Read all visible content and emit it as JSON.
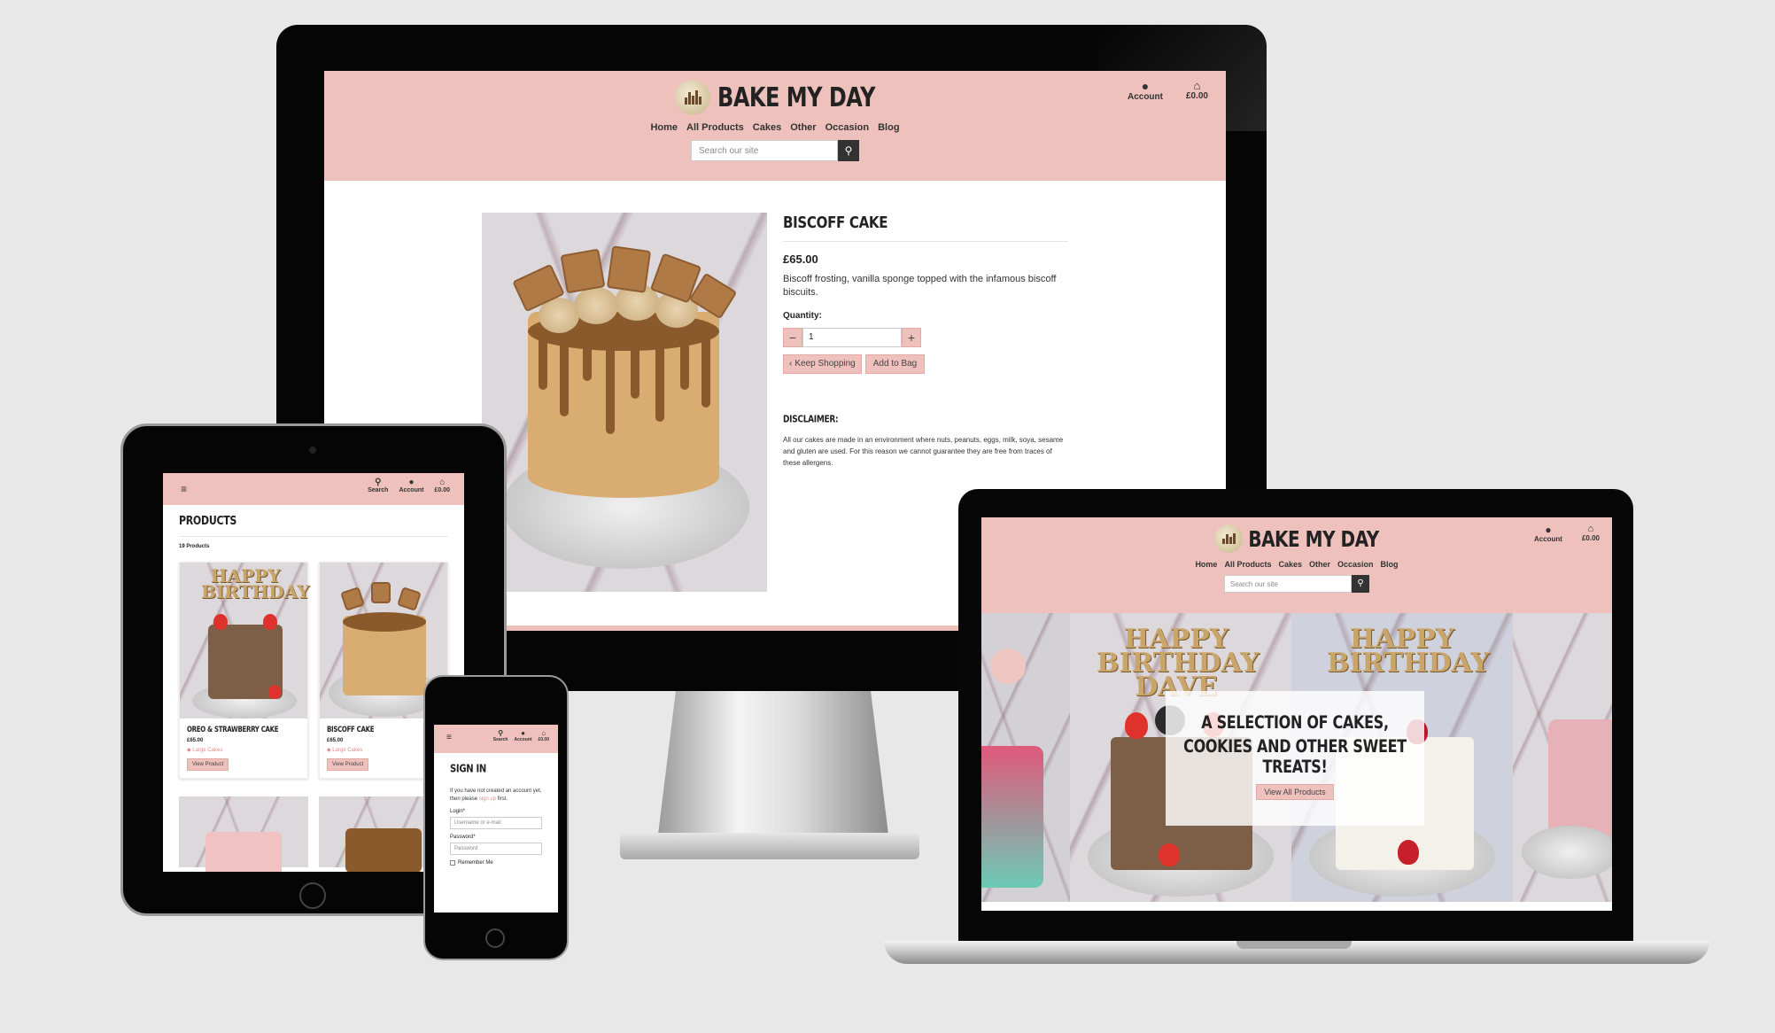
{
  "site": {
    "brand": "BAKE MY DAY",
    "nav": [
      "Home",
      "All Products",
      "Cakes",
      "Other",
      "Occasion",
      "Blog"
    ],
    "search_placeholder": "Search our site",
    "account_label": "Account",
    "search_label": "Search",
    "bag_total": "£0.00"
  },
  "product_page": {
    "title": "BISCOFF CAKE",
    "price": "£65.00",
    "description": "Biscoff frosting, vanilla sponge topped with the infamous biscoff biscuits.",
    "quantity_label": "Quantity:",
    "quantity_value": "1",
    "minus": "−",
    "plus": "+",
    "keep_shopping": "Keep Shopping",
    "add_to_bag": "Add to Bag",
    "disclaimer_title": "DISCLAIMER:",
    "disclaimer_text": "All our cakes are made in an environment where nuts, peanuts, eggs, milk, soya, sesame and gluten are used. For this reason we cannot guarantee they are free from traces of these allergens."
  },
  "products_page": {
    "title": "PRODUCTS",
    "count": "19 Products",
    "cards": [
      {
        "name": "OREO & STRAWBERRY CAKE",
        "price": "£65.00",
        "category": "Large Cakes",
        "button": "View Product"
      },
      {
        "name": "BISCOFF CAKE",
        "price": "£65.00",
        "category": "Large Cakes",
        "button": "View Product"
      }
    ]
  },
  "signin_page": {
    "title": "SIGN IN",
    "intro_before": "If you have not created an account yet, then please ",
    "signup_link": "sign up",
    "intro_after": " first.",
    "login_label": "Login*",
    "login_placeholder": "Username or e-mail",
    "password_label": "Password*",
    "password_placeholder": "Password",
    "remember": "Remember Me"
  },
  "home_page": {
    "hero_line1": "A SELECTION OF CAKES,",
    "hero_line2": "COOKIES AND OTHER SWEET TREATS!",
    "hero_button": "View All Products",
    "topper1": "HAPPY BIRTHDAY DAVE",
    "topper2": "HAPPY BIRTHDAY"
  },
  "colors": {
    "header_pink": "#eec1bd",
    "button_pink": "#eec1bd",
    "category_pink": "#e38b8b",
    "search_button": "#333333"
  },
  "icons": [
    "user-icon",
    "basket-icon",
    "search-icon",
    "hamburger-icon",
    "chevron-left-icon",
    "tag-icon"
  ]
}
